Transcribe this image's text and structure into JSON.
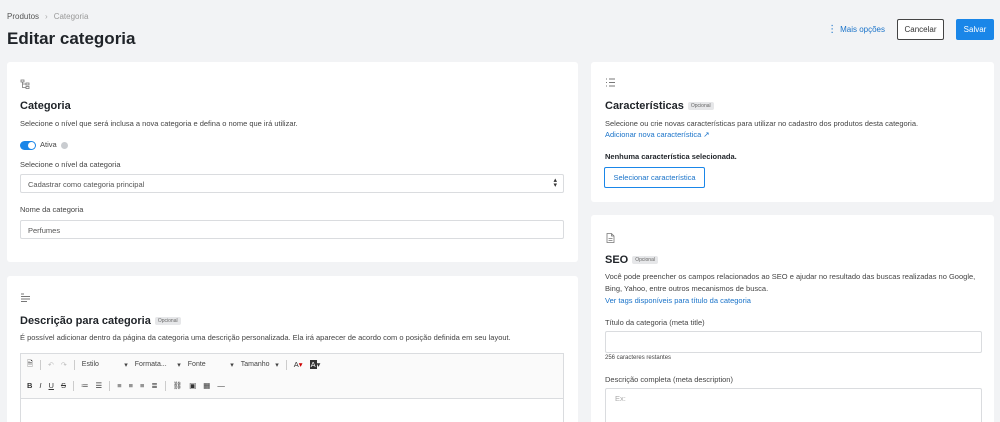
{
  "breadcrumb": {
    "root": "Produtos",
    "current": "Categoria"
  },
  "page_title": "Editar categoria",
  "actions": {
    "more": "Mais opções",
    "cancel": "Cancelar",
    "save": "Salvar"
  },
  "category_card": {
    "title": "Categoria",
    "description": "Selecione o nível que será inclusa a nova categoria e defina o nome que irá utilizar.",
    "active_label": "Ativa",
    "level_label": "Selecione o nível da categoria",
    "level_value": "Cadastrar como categoria principal",
    "name_label": "Nome da categoria",
    "name_value": "Perfumes"
  },
  "description_card": {
    "title": "Descrição para categoria",
    "badge": "Opcional",
    "text": "É possível adicionar dentro da página da categoria uma descrição personalizada. Ela irá aparecer de acordo com o posição definida em seu layout.",
    "toolbar": {
      "style": "Estilo",
      "format": "Formata...",
      "font": "Fonte",
      "size": "Tamanho"
    }
  },
  "features_card": {
    "title": "Características",
    "badge": "Opcional",
    "description": "Selecione ou crie novas características para utilizar no cadastro dos produtos desta categoria.",
    "add_link": "Adicionar nova característica",
    "empty_text": "Nenhuma característica selecionada.",
    "select_button": "Selecionar característica"
  },
  "seo_card": {
    "title": "SEO",
    "badge": "Opcional",
    "description": "Você pode preencher os campos relacionados ao SEO e ajudar no resultado das buscas realizadas no Google, Bing, Yahoo, entre outros mecanismos de busca.",
    "tags_link": "Ver tags disponíveis para título da categoria",
    "meta_title_label": "Título da categoria (meta title)",
    "meta_title_counter": "256 caracteres restantes",
    "meta_desc_label": "Descrição completa (meta description)",
    "meta_desc_placeholder": "Ex:"
  },
  "colors": {
    "accent": "#1a86e8",
    "link": "#1a73c9",
    "background": "#f2f3f5"
  }
}
